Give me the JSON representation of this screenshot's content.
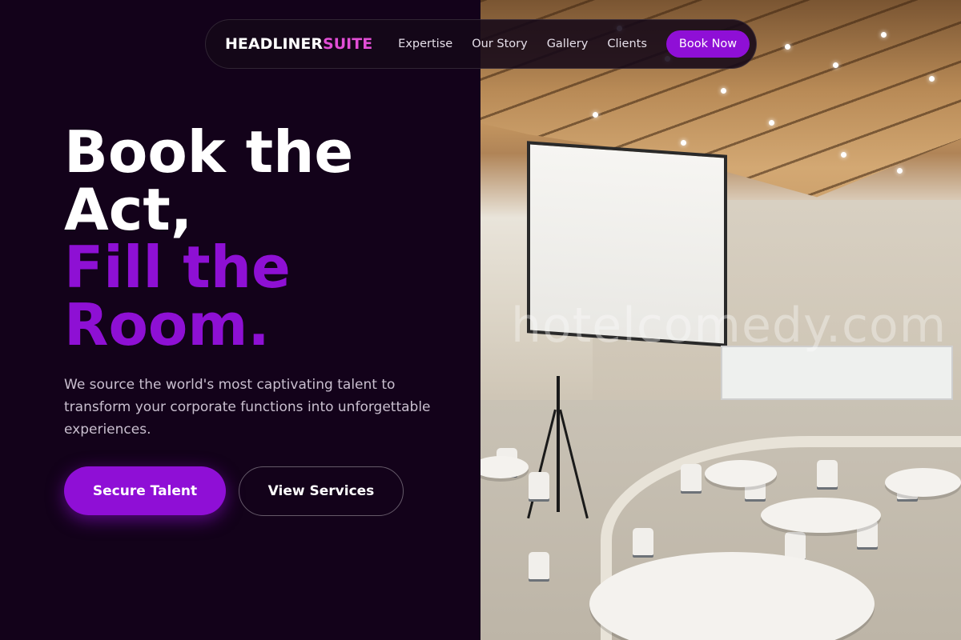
{
  "nav": {
    "logo_main": "HEADLINER",
    "logo_accent": "SUITE",
    "links": [
      "Expertise",
      "Our Story",
      "Gallery",
      "Clients"
    ],
    "cta": "Book Now"
  },
  "hero": {
    "title_line1": "Book the",
    "title_line2": "Act,",
    "title_line3": "Fill the",
    "title_line4": "Room.",
    "subtitle": "We source the world's most captivating talent to transform your corporate functions into unforgettable experiences.",
    "primary_button": "Secure Talent",
    "secondary_button": "View Services"
  },
  "image": {
    "watermark": "hotelcomedy.com"
  },
  "colors": {
    "background": "#13021a",
    "accent_purple": "#8f0fd6",
    "logo_accent_pink": "#e24ed6",
    "text_white": "#ffffff",
    "text_muted": "#c9bfcf"
  }
}
